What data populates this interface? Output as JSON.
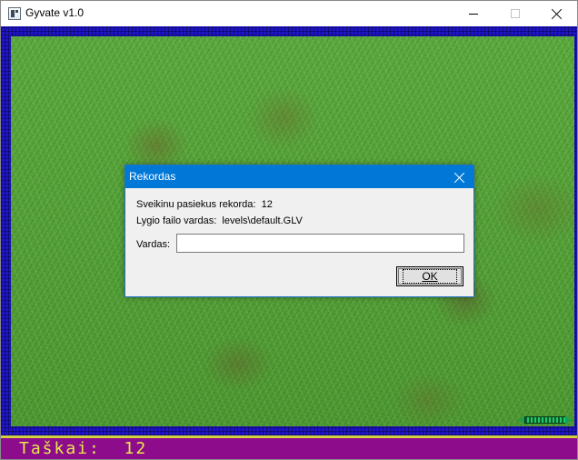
{
  "window": {
    "title": "Gyvate v1.0"
  },
  "dialog": {
    "title": "Rekordas",
    "record_label": "Sveikinu pasiekus rekorda:",
    "record_value": "12",
    "level_label": "Lygio failo vardas:",
    "level_value": "levels\\default.GLV",
    "name_label": "Vardas:",
    "name_value": "",
    "ok_label": "OK"
  },
  "score": {
    "label": "Taškai:",
    "value": "12"
  },
  "colors": {
    "border": "#1e14c8",
    "grass": "#4e9a34",
    "score_bg": "#8c0c8c",
    "score_text": "#e8e84a",
    "snake": "#16a050",
    "dialog_titlebar": "#0078d7"
  },
  "icons": {
    "app": "app-window-icon",
    "minimize": "minimize-icon",
    "maximize": "maximize-icon",
    "close": "close-icon"
  }
}
